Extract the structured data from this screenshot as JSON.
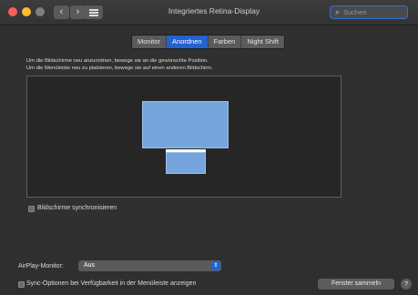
{
  "window": {
    "title": "Integriertes Retina-Display",
    "nav_back_icon": "chevron-left-icon",
    "nav_forward_icon": "chevron-right-icon",
    "show_all_icon": "grid-icon",
    "search_placeholder": "Suchen"
  },
  "tabs": [
    {
      "label": "Monitor",
      "active": false
    },
    {
      "label": "Anordnen",
      "active": true
    },
    {
      "label": "Farben",
      "active": false
    },
    {
      "label": "Night Shift",
      "active": false
    }
  ],
  "instructions": {
    "line1": "Um die Bildschirme neu anzuordnen, bewege sie an die gewünschte Position.",
    "line2": "Um die Menüleiste neu zu platzieren, bewege sie auf einen anderen Bildschirm."
  },
  "mirror_displays": {
    "label": "Bildschirme synchronisieren",
    "checked": false
  },
  "airplay": {
    "label": "AirPlay-Monitor:",
    "value": "Aus"
  },
  "sync_options": {
    "label": "Sync-Optionen bei Verfügbarkeit in der Menüleiste anzeigen",
    "checked": false
  },
  "buttons": {
    "gather_windows": "Fenster sammeln",
    "help": "?"
  },
  "colors": {
    "accent": "#2462d0",
    "display": "#76a5dd"
  }
}
